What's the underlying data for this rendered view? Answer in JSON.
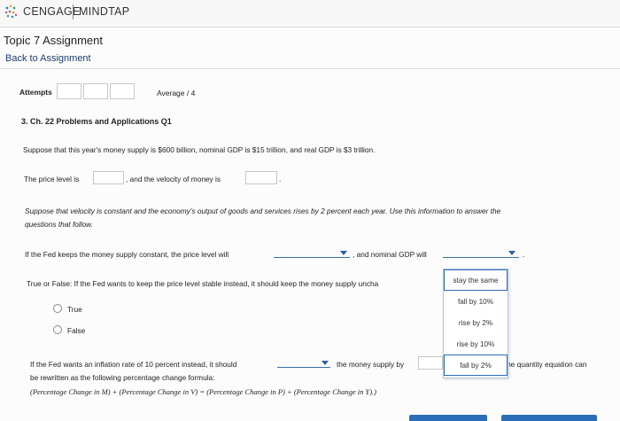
{
  "header": {
    "brand": "CENGAGE",
    "product": "MINDTAP",
    "page_title": "Topic 7 Assignment",
    "back_link": "Back to Assignment"
  },
  "attempts": {
    "label": "Attempts",
    "average_label": "Average / 4"
  },
  "question": {
    "title": "3. Ch. 22 Problems and Applications Q1",
    "intro": "Suppose that this year's money supply is $600 billion, nominal GDP is $15 trillion, and real GDP is $3 trillion.",
    "price_level_pre": "The price level is",
    "price_level_mid": ", and the velocity of money is",
    "price_level_end": ".",
    "assume_line1": "Suppose that velocity is constant and the economy's output of goods and services rises by 2 percent each year. Use this information to answer the",
    "assume_line2": "questions that follow.",
    "fed_constant_pre": "If the Fed keeps the money supply constant, the price level will",
    "fed_constant_mid": ", and nominal GDP will",
    "tf_prompt": "True or False: If the Fed wants to keep the price level stable instead, it should keep the money supply uncha",
    "options": [
      "True",
      "False"
    ],
    "inflation_pre": "If the Fed wants an inflation rate of 10 percent instead, it should",
    "inflation_mid": "the money supply by",
    "inflation_tail": "The quantity equation can",
    "rewrite_line": "be rewritten as the following percentage change formula:",
    "formula": "(Percentage Change in M) + (Percentage Change in V) = (Percentage Change in P) + (Percentage Change in Y).)"
  },
  "dropdown": {
    "options": [
      "stay the same",
      "fall by 10%",
      "rise by 2%",
      "rise by 10%",
      "fall by 2%"
    ]
  },
  "colors": {
    "accent": "#2b6db8",
    "link": "#1b3d72"
  }
}
